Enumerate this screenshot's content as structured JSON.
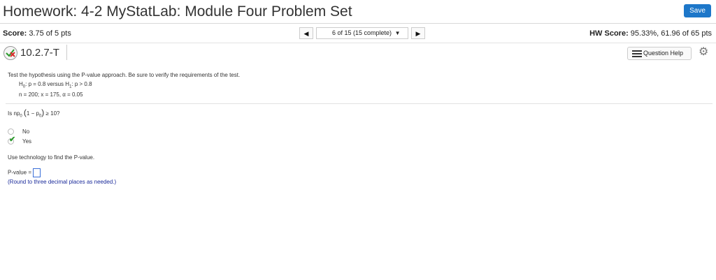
{
  "header": {
    "title": "Homework: 4-2 MyStatLab: Module Four Problem Set",
    "save_label": "Save"
  },
  "score": {
    "label": "Score:",
    "value": "3.75 of 5 pts"
  },
  "nav": {
    "position": "6 of 15 (15 complete)",
    "prev_icon": "triangle-left",
    "next_icon": "triangle-right"
  },
  "hw_score": {
    "label": "HW Score:",
    "value": "95.33%, 61.96 of 65 pts"
  },
  "question": {
    "id": "10.2.7-T",
    "help_label": "Question Help"
  },
  "content": {
    "instruction": "Test the hypothesis using the P-value approach. Be sure to verify the requirements of the test.",
    "h0": "p = 0.8 versus H",
    "h1_rest": ": p > 0.8",
    "givens": "n = 200; x = 175, α = 0.05",
    "condition_question": "≥ 10?",
    "options": [
      {
        "label": "No",
        "selected": false
      },
      {
        "label": "Yes",
        "selected": true
      }
    ],
    "tech_prompt": "Use technology to find the P-value.",
    "pvalue_label": "P-value =",
    "round_note": "(Round to three decimal places as needed.)"
  },
  "colors": {
    "accent": "#1d77c9",
    "note": "#1a2a9a",
    "correct": "#2a9a2a"
  }
}
